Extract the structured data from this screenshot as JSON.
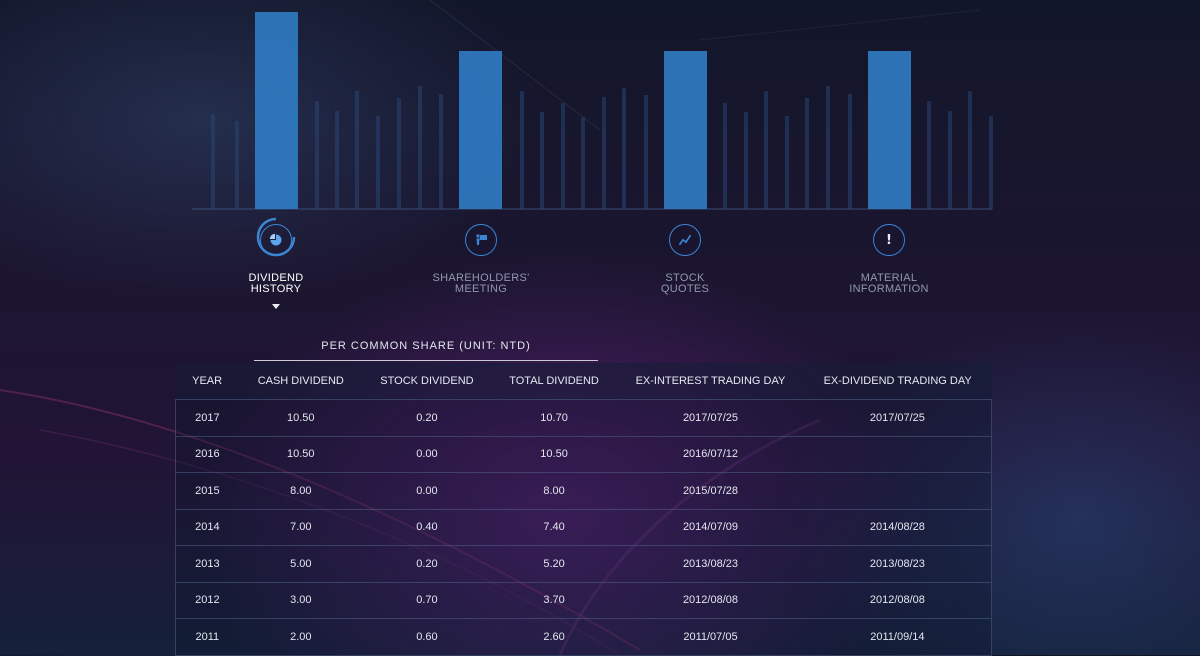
{
  "nav": {
    "items": [
      {
        "label": "DIVIDEND\nHISTORY",
        "icon": "pie-chart-icon",
        "active": true
      },
      {
        "label": "SHAREHOLDERS'\nMEETING",
        "icon": "presenter-icon",
        "active": false
      },
      {
        "label": "STOCK\nQUOTES",
        "icon": "line-chart-icon",
        "active": false
      },
      {
        "label": "MATERIAL\nINFORMATION",
        "icon": "exclamation-icon",
        "active": false
      }
    ]
  },
  "table": {
    "subtitle": "PER COMMON SHARE (UNIT: NTD)",
    "columns": [
      "YEAR",
      "CASH DIVIDEND",
      "STOCK DIVIDEND",
      "TOTAL DIVIDEND",
      "EX-INTEREST TRADING DAY",
      "EX-DIVIDEND TRADING DAY"
    ],
    "rows": [
      [
        "2017",
        "10.50",
        "0.20",
        "10.70",
        "2017/07/25",
        "2017/07/25"
      ],
      [
        "2016",
        "10.50",
        "0.00",
        "10.50",
        "2016/07/12",
        ""
      ],
      [
        "2015",
        "8.00",
        "0.00",
        "8.00",
        "2015/07/28",
        ""
      ],
      [
        "2014",
        "7.00",
        "0.40",
        "7.40",
        "2014/07/09",
        "2014/08/28"
      ],
      [
        "2013",
        "5.00",
        "0.20",
        "5.20",
        "2013/08/23",
        "2013/08/23"
      ],
      [
        "2012",
        "3.00",
        "0.70",
        "3.70",
        "2012/08/08",
        "2012/08/08"
      ],
      [
        "2011",
        "2.00",
        "0.60",
        "2.60",
        "2011/07/05",
        "2011/09/14"
      ]
    ]
  },
  "colors": {
    "accent": "#3a86d4",
    "bar_highlight": "#2f7cc4",
    "bar_dim": "#1e3558"
  }
}
